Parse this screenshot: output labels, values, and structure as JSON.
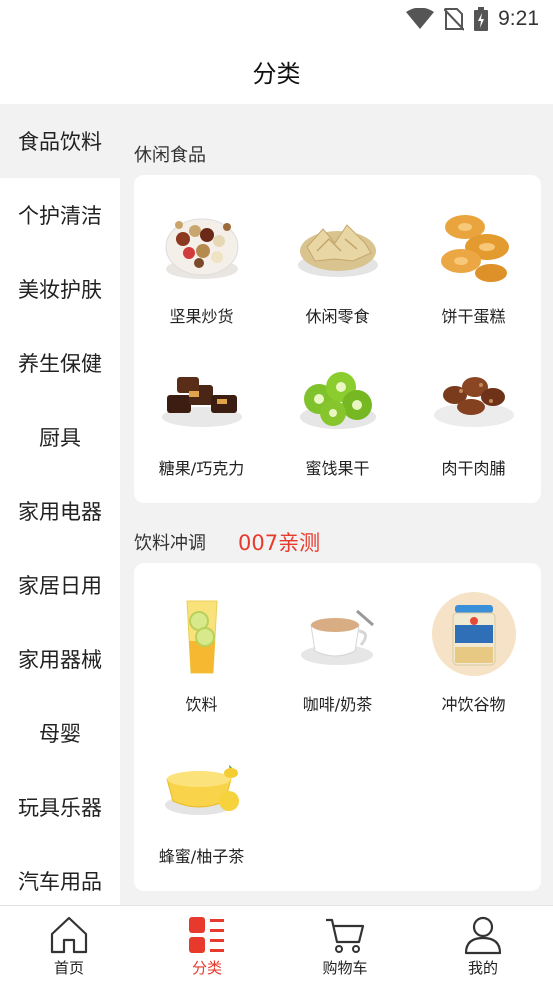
{
  "status_bar": {
    "time": "9:21",
    "icons": [
      "wifi-icon",
      "no-sim-icon",
      "battery-charging-icon"
    ]
  },
  "header": {
    "title": "分类"
  },
  "sidebar": {
    "items": [
      {
        "label": "食品饮料",
        "active": true
      },
      {
        "label": "个护清洁"
      },
      {
        "label": "美妆护肤"
      },
      {
        "label": "养生保健"
      },
      {
        "label": "厨具"
      },
      {
        "label": "家用电器"
      },
      {
        "label": "家居日用"
      },
      {
        "label": "家用器械"
      },
      {
        "label": "母婴"
      },
      {
        "label": "玩具乐器"
      },
      {
        "label": "汽车用品"
      }
    ]
  },
  "sections": [
    {
      "title": "休闲食品",
      "items": [
        {
          "label": "坚果炒货",
          "icon": "mixed-nuts-bowl-icon"
        },
        {
          "label": "休闲零食",
          "icon": "chips-bowl-icon"
        },
        {
          "label": "饼干蛋糕",
          "icon": "butter-cookies-icon"
        },
        {
          "label": "糖果/巧克力",
          "icon": "chocolate-bars-icon"
        },
        {
          "label": "蜜饯果干",
          "icon": "dried-kiwi-icon"
        },
        {
          "label": "肉干肉脯",
          "icon": "jerky-plate-icon"
        }
      ]
    },
    {
      "title": "饮料冲调",
      "note": "007亲测",
      "items": [
        {
          "label": "饮料",
          "icon": "lemon-drink-icon"
        },
        {
          "label": "咖啡/奶茶",
          "icon": "milk-tea-cup-icon"
        },
        {
          "label": "冲饮谷物",
          "icon": "oat-jar-icon"
        },
        {
          "label": "蜂蜜/柚子茶",
          "icon": "citron-tea-bowl-icon"
        }
      ]
    }
  ],
  "bottom_nav": [
    {
      "label": "首页",
      "icon": "home-icon"
    },
    {
      "label": "分类",
      "icon": "category-icon",
      "active": true
    },
    {
      "label": "购物车",
      "icon": "cart-icon"
    },
    {
      "label": "我的",
      "icon": "profile-icon"
    }
  ],
  "colors": {
    "accent": "#e83a2c",
    "background": "#f2f2f2",
    "card": "#ffffff"
  }
}
